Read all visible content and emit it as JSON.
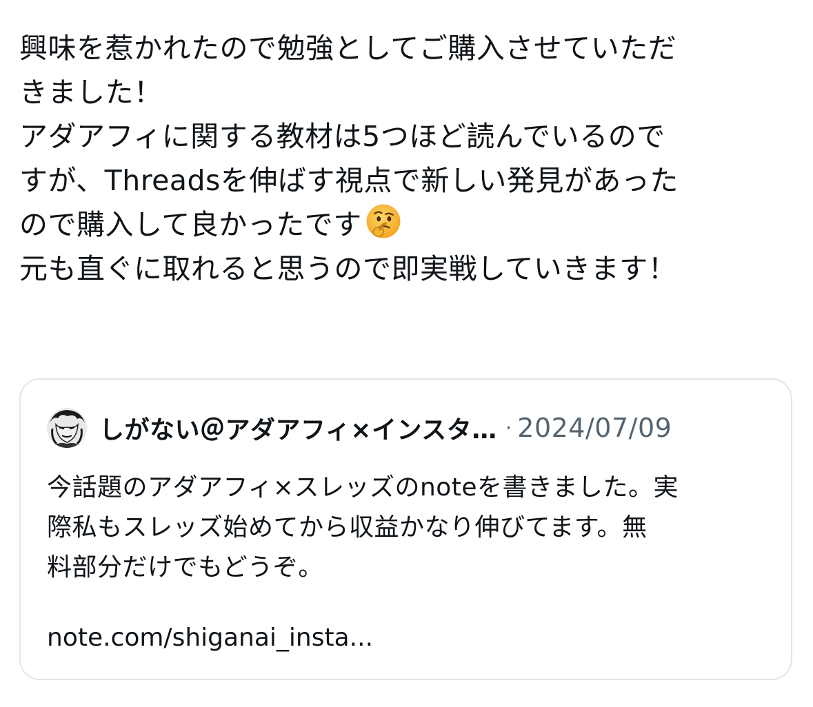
{
  "post": {
    "lines": [
      "興味を惹かれたので勉強としてご購入させていただ",
      "きました！",
      "アダアフィに関する教材は5つほど読んでいるので",
      "すが、Threadsを伸ばす視点で新しい発見があった",
      "ので購入して良かったです",
      "元も直ぐに取れると思うので即実戦していきます！"
    ],
    "emoji_icon": "thinking-face-icon"
  },
  "quote": {
    "author_name": "しがない＠アダアフィ×インスタ…",
    "separator": "·",
    "date": "2024/07/09",
    "lines": [
      "今話題のアダアフィ×スレッズのnoteを書きました。実",
      "際私もスレッズ始めてから収益かなり伸びてます。無",
      "料部分だけでもどうぞ。"
    ],
    "link": "note.com/shiganai_insta..."
  },
  "colors": {
    "text": "#0f1419",
    "secondary": "#536471",
    "border": "#e3e6e9"
  }
}
